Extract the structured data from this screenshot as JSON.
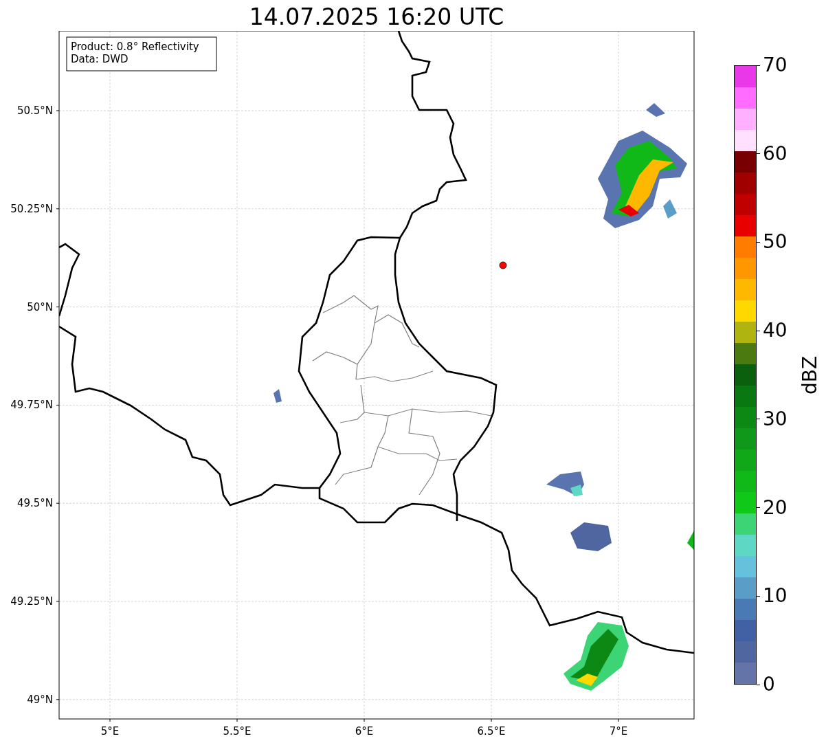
{
  "title": "14.07.2025 16:20 UTC",
  "info_box": [
    "Product: 0.8° Reflectivity",
    "Data: DWD"
  ],
  "map": {
    "xticks": [
      "5°E",
      "5.5°E",
      "6°E",
      "6.5°E",
      "7°E"
    ],
    "yticks": [
      "50.5°N",
      "50.25°N",
      "50°N",
      "49.75°N",
      "49.5°N",
      "49.25°N",
      "49°N"
    ]
  },
  "colorbar": {
    "label": "dBZ",
    "ticks": [
      "70",
      "60",
      "50",
      "40",
      "30",
      "20",
      "10",
      "0"
    ],
    "bins": [
      {
        "color": "#e838e8"
      },
      {
        "color": "#ff6cff"
      },
      {
        "color": "#ffb0ff"
      },
      {
        "color": "#ffe0ff"
      },
      {
        "color": "#780000"
      },
      {
        "color": "#a00000"
      },
      {
        "color": "#c00000"
      },
      {
        "color": "#e80000"
      },
      {
        "color": "#ff7c00"
      },
      {
        "color": "#ff9800"
      },
      {
        "color": "#ffb800"
      },
      {
        "color": "#ffd800"
      },
      {
        "color": "#b0b410"
      },
      {
        "color": "#4a7a10"
      },
      {
        "color": "#0a600c"
      },
      {
        "color": "#0a7810"
      },
      {
        "color": "#0c8814"
      },
      {
        "color": "#10981a"
      },
      {
        "color": "#10a818"
      },
      {
        "color": "#10b818"
      },
      {
        "color": "#10c818"
      },
      {
        "color": "#3cd474"
      },
      {
        "color": "#5ed8c4"
      },
      {
        "color": "#66c2dc"
      },
      {
        "color": "#5a9ec8"
      },
      {
        "color": "#4a7ab4"
      },
      {
        "color": "#4260a4"
      },
      {
        "color": "#5066a0"
      },
      {
        "color": "#6574a8"
      }
    ]
  }
}
